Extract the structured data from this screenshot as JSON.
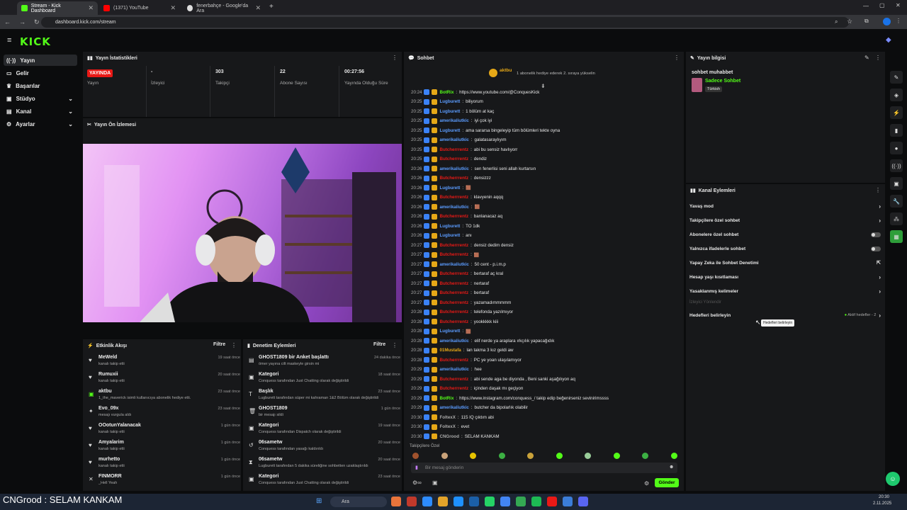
{
  "browser": {
    "tabs": [
      {
        "label": "Stream - Kick Dashboard",
        "active": true
      },
      {
        "label": "(1371) YouTube",
        "active": false
      },
      {
        "label": "fenerbahçe - Google'da Ara",
        "active": false
      }
    ],
    "url": "dashboard.kick.com/stream"
  },
  "brand": {
    "logo": "KICK",
    "accent": "#53fc18"
  },
  "sidebar": {
    "items": [
      {
        "label": "Yayın",
        "icon": "broadcast-icon"
      },
      {
        "label": "Gelir",
        "icon": "income-icon"
      },
      {
        "label": "Başarılar",
        "icon": "trophy-icon"
      },
      {
        "label": "Stüdyo",
        "icon": "studio-icon"
      },
      {
        "label": "Kanal",
        "icon": "channel-icon"
      },
      {
        "label": "Ayarlar",
        "icon": "gear-icon"
      }
    ]
  },
  "stats": {
    "title": "Yayın İstatistikleri",
    "items": [
      {
        "value": "YAYINDA",
        "label": "Yayın"
      },
      {
        "value": "-",
        "label": "İzleyici"
      },
      {
        "value": "303",
        "label": "Takipçi"
      },
      {
        "value": "22",
        "label": "Abone Sayısı"
      },
      {
        "value": "00:27:56",
        "label": "Yayında Olduğu Süre"
      }
    ]
  },
  "preview": {
    "title": "Yayın Ön İzlemesi"
  },
  "activity": {
    "title": "Etkinlik Akışı",
    "filter": "Filtre",
    "items": [
      {
        "name": "MeWeld",
        "sub": "kanalı takip etti",
        "time": "19 saat önce",
        "icon": "heart-icon"
      },
      {
        "name": "Rumuxii",
        "sub": "kanalı takip etti",
        "time": "20 saat önce",
        "icon": "heart-icon"
      },
      {
        "name": "aktbu",
        "sub": "1_the_maverick isimli kullanıcıya abonelik hediye etti.",
        "time": "23 saat önce",
        "icon": "gift-icon"
      },
      {
        "name": "Evo_09x",
        "sub": "mesajı vurgula aldı",
        "time": "23 saat önce",
        "icon": "highlight-icon"
      },
      {
        "name": "OOotunYalanacak",
        "sub": "kanalı takip etti",
        "time": "1 gün önce",
        "icon": "heart-icon"
      },
      {
        "name": "Amyalarim",
        "sub": "kanalı takip etti",
        "time": "1 gün önce",
        "icon": "heart-icon"
      },
      {
        "name": "murhetto",
        "sub": "kanalı takip etti",
        "time": "1 gün önce",
        "icon": "heart-icon"
      },
      {
        "name": "FINMORR",
        "sub": "_Hell Yeah",
        "time": "1 gün önce",
        "icon": "x-icon"
      }
    ]
  },
  "moderation": {
    "title": "Denetim Eylemleri",
    "filter": "Filtre",
    "items": [
      {
        "name": "GHOST1809 bir Anket başlattı",
        "sub": "ömer yayına cilt maskeyle girsin mi",
        "time": "24 dakika önce",
        "icon": "poll-icon"
      },
      {
        "name": "Kategori",
        "sub": "Conquess tarafından Just Chatting olarak değiştirildi",
        "time": "18 saat önce",
        "icon": "category-icon"
      },
      {
        "name": "Başlık",
        "sub": "Lugburett tarafından süper mi kahraman 1&2 Bölüm olarak değiştirildi",
        "time": "23 saat önce",
        "icon": "title-icon"
      },
      {
        "name": "GHOST1809",
        "sub": "bir mesajı sildi",
        "time": "1 gün önce",
        "icon": "trash-icon"
      },
      {
        "name": "Kategori",
        "sub": "Conquess tarafından Dispatch olarak değiştirildi",
        "time": "19 saat önce",
        "icon": "category-icon"
      },
      {
        "name": "06sametw",
        "sub": "Conquess tarafından yasağı kaldırıldı",
        "time": "20 saat önce",
        "icon": "unban-icon"
      },
      {
        "name": "06sametw",
        "sub": "Lugburett tarafından 5 dakika süreliğine sohbetten uzaklaştırıldı",
        "time": "20 saat önce",
        "icon": "timeout-icon"
      },
      {
        "name": "Kategori",
        "sub": "Conquess tarafından Just Chatting olarak değiştirildi",
        "time": "23 saat önce",
        "icon": "category-icon"
      }
    ]
  },
  "chat": {
    "title": "Sohbet",
    "pinned_user": "aktbu",
    "pinned_text": "1 abonelik hediye ederek 2. sıraya yükselin",
    "messages": [
      {
        "t": "20:24",
        "u": "BotRix",
        "c": "#53fc18",
        "m": "https://www.youtube.com/@ConquesKick"
      },
      {
        "t": "20:25",
        "u": "Lugburett",
        "c": "#5b9cff",
        "m": "biliyorum"
      },
      {
        "t": "20:25",
        "u": "Lugburett",
        "c": "#5b9cff",
        "m": "1 bölüm at kaç"
      },
      {
        "t": "20:25",
        "u": "amerikaliutkic",
        "c": "#5b9cff",
        "m": "iyi çok iyi"
      },
      {
        "t": "20:25",
        "u": "Lugburett",
        "c": "#5b9cff",
        "m": "ama sararsa bingeleyip tüm bölümleri tekte oyna"
      },
      {
        "t": "20:25",
        "u": "amerikaliutkic",
        "c": "#5b9cff",
        "m": "galatasaraylıyım"
      },
      {
        "t": "20:25",
        "u": "Butcherrrentz",
        "c": "#e91916",
        "m": "abi bu sensiz havlıyorr"
      },
      {
        "t": "20:25",
        "u": "Butcherrrentz",
        "c": "#e91916",
        "m": "dendiz"
      },
      {
        "t": "20:26",
        "u": "amerikaliutkic",
        "c": "#5b9cff",
        "m": "sen fenerlisi seni allah kurtarsın"
      },
      {
        "t": "20:26",
        "u": "Butcherrrentz",
        "c": "#e91916",
        "m": "densizzz"
      },
      {
        "t": "20:26",
        "u": "Lugburett",
        "c": "#5b9cff",
        "m": "🟫"
      },
      {
        "t": "20:26",
        "u": "Butcherrrentz",
        "c": "#e91916",
        "m": "klavyenin aqqq"
      },
      {
        "t": "20:26",
        "u": "amerikaliutkic",
        "c": "#5b9cff",
        "m": "🟫"
      },
      {
        "t": "20:26",
        "u": "Butcherrrentz",
        "c": "#e91916",
        "m": "banlanacaz aq"
      },
      {
        "t": "20:26",
        "u": "Lugburett",
        "c": "#5b9cff",
        "m": "TO 1dk"
      },
      {
        "t": "20:26",
        "u": "Lugburett",
        "c": "#5b9cff",
        "m": "anı"
      },
      {
        "t": "20:27",
        "u": "Butcherrrentz",
        "c": "#e91916",
        "m": "densiz dedim densiz"
      },
      {
        "t": "20:27",
        "u": "Butcherrrentz",
        "c": "#e91916",
        "m": "🟫"
      },
      {
        "t": "20:27",
        "u": "amerikaliutkic",
        "c": "#5b9cff",
        "m": "50 cent - p.i.m.p"
      },
      {
        "t": "20:27",
        "u": "Butcherrrentz",
        "c": "#e91916",
        "m": "bertaraf aç kral"
      },
      {
        "t": "20:27",
        "u": "Butcherrrentz",
        "c": "#e91916",
        "m": "nertaraf"
      },
      {
        "t": "20:27",
        "u": "Butcherrrentz",
        "c": "#e91916",
        "m": "bertaraf"
      },
      {
        "t": "20:27",
        "u": "Butcherrrentz",
        "c": "#e91916",
        "m": "yazamadımmmmm"
      },
      {
        "t": "20:28",
        "u": "Butcherrrentz",
        "c": "#e91916",
        "m": "telefonda yazılmıyor"
      },
      {
        "t": "20:28",
        "u": "Butcherrrentz",
        "c": "#e91916",
        "m": "yookkkkk kiii"
      },
      {
        "t": "20:28",
        "u": "Lugburett",
        "c": "#5b9cff",
        "m": "🟫"
      },
      {
        "t": "20:28",
        "u": "amerikaliutkic",
        "c": "#5b9cff",
        "m": "elif nerde ya araplara ırkçılık yapacağıdık"
      },
      {
        "t": "20:28",
        "u": "01Mustafa",
        "c": "#e6a817",
        "m": "lan takma 3 kız geldi aw"
      },
      {
        "t": "20:28",
        "u": "Butcherrrentz",
        "c": "#e91916",
        "m": "PC ye yoan ulaşılamıyor"
      },
      {
        "t": "20:29",
        "u": "amerikaliutkic",
        "c": "#5b9cff",
        "m": "hee"
      },
      {
        "t": "20:29",
        "u": "Butcherrrentz",
        "c": "#e91916",
        "m": "abi sende aga be diyonda , Beni sanki aşağılıyon aq"
      },
      {
        "t": "20:29",
        "u": "Butcherrrentz",
        "c": "#e91916",
        "m": "içinden daşak mı geçiyon"
      },
      {
        "t": "20:29",
        "u": "BotRix",
        "c": "#53fc18",
        "m": "https://www.instagram.com/conquess_/ takip edip beğenirseniz sevinirimssss"
      },
      {
        "t": "20:29",
        "u": "amerikaliutkic",
        "c": "#5b9cff",
        "m": "butcher da bipolarlık olabilir"
      },
      {
        "t": "20:30",
        "u": "FoltexX",
        "c": "#aaaaaa",
        "m": "115 IQ çıktım abi"
      },
      {
        "t": "20:30",
        "u": "FoltexX",
        "c": "#aaaaaa",
        "m": "evet"
      },
      {
        "t": "20:30",
        "u": "CNGrood",
        "c": "#aaaaaa",
        "m": "SELAM KANKAM"
      }
    ],
    "followers_only": "Takipçilere Özel",
    "input_placeholder": "Bir mesaj gönderin",
    "send": "Gönder"
  },
  "stream_info": {
    "title": "Yayın bilgisi",
    "stream_title": "sohbet muhabbet",
    "category": "Sadece Sohbet",
    "language": "Türkish"
  },
  "channel_actions": {
    "title": "Kanal Eylemleri",
    "items": [
      {
        "label": "Yavaş mod",
        "control": "chevron"
      },
      {
        "label": "Takipçilere özel sohbet",
        "control": "chevron"
      },
      {
        "label": "Abonelere özel sohbet",
        "control": "toggle"
      },
      {
        "label": "Yalnızca ifadelerle sohbet",
        "control": "toggle"
      },
      {
        "label": "Yapay Zeka ile Sohbet Denetimi",
        "control": "external"
      },
      {
        "label": "Hesap yaşı kısıtlaması",
        "control": "chevron"
      },
      {
        "label": "Yasaklanmış kelimeler",
        "control": "chevron"
      }
    ],
    "viewer_goals_header": "İzleyici Yönlendir",
    "goals_label": "Hedefleri belirleyin",
    "goals_status": "Aktif hedefler - 2",
    "tooltip": "Hedefleri belirleyin"
  },
  "overlay_caption": {
    "user": "CNGrood",
    "text": ": SELAM KANKAM"
  },
  "taskbar": {
    "search": "Ara",
    "time": "20:30",
    "date": "2.11.2025"
  }
}
